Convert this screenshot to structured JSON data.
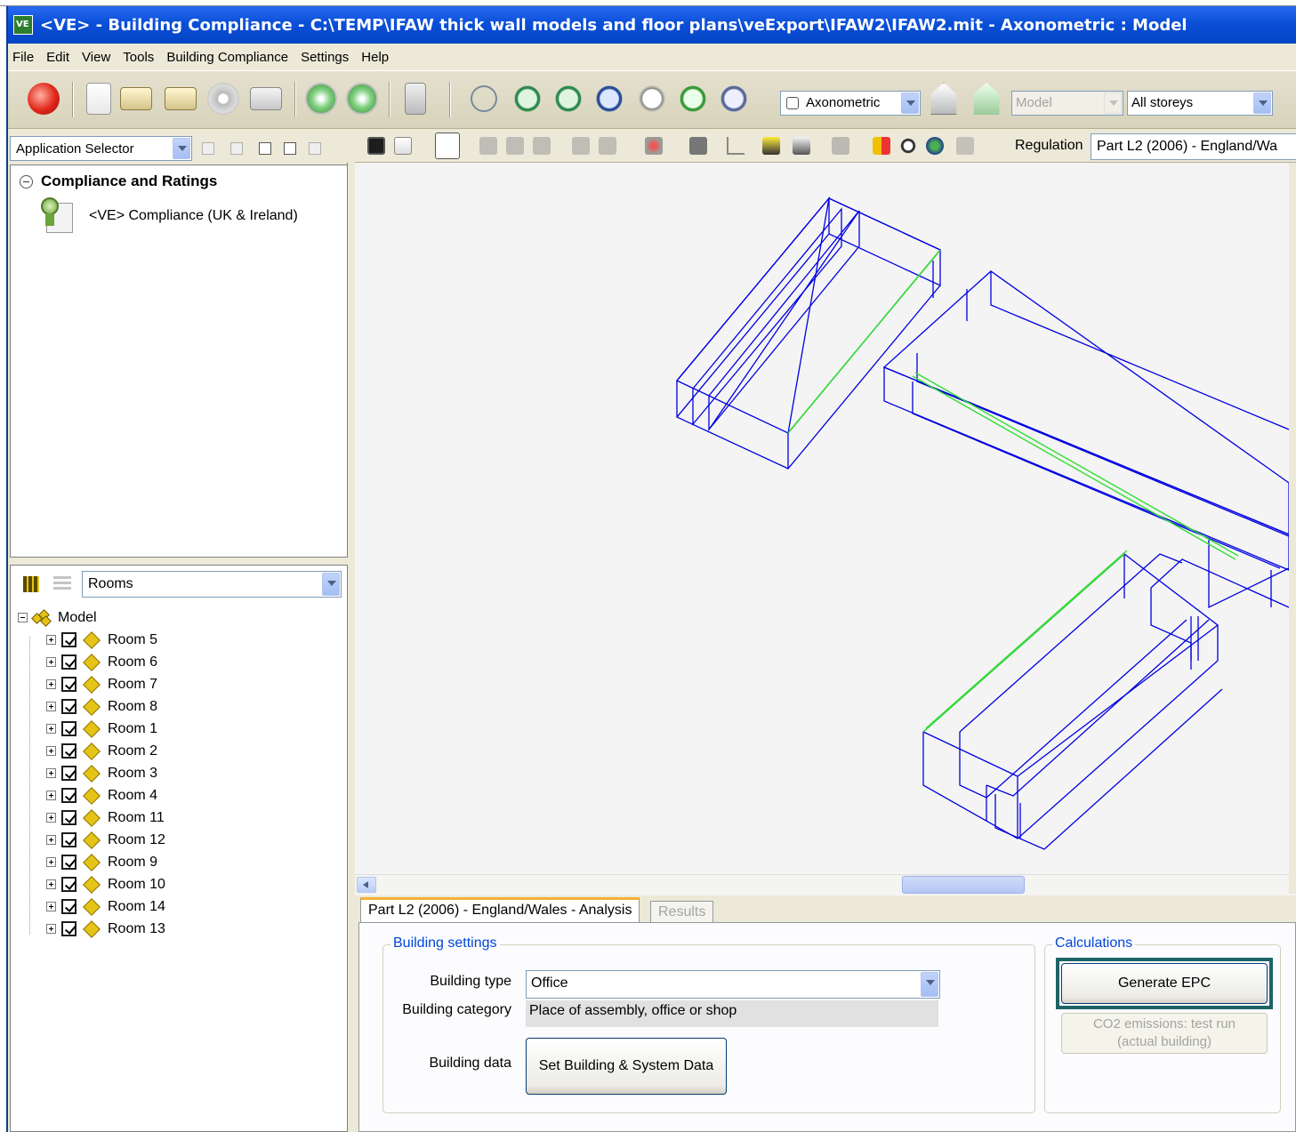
{
  "window": {
    "title": "<VE> - Building Compliance - C:\\TEMP\\IFAW thick wall models and floor plans\\veExport\\IFAW2\\IFAW2.mit - Axonometric : Model"
  },
  "menu": [
    "File",
    "Edit",
    "View",
    "Tools",
    "Building Compliance",
    "Settings",
    "Help"
  ],
  "toolbar": {
    "view_select": "Axonometric",
    "model_select": "Model",
    "storey_select": "All storeys"
  },
  "left": {
    "app_selector": "Application Selector",
    "compliance_heading": "Compliance and Ratings",
    "compliance_item": "<VE> Compliance (UK & Ireland)",
    "browser_select": "Rooms",
    "tree_root": "Model",
    "rooms": [
      "Room 5",
      "Room 6",
      "Room 7",
      "Room 8",
      "Room 1",
      "Room 2",
      "Room 3",
      "Room 4",
      "Room 11",
      "Room 12",
      "Room 9",
      "Room 10",
      "Room 14",
      "Room 13"
    ]
  },
  "viewport": {
    "regulation_label": "Regulation",
    "regulation_value": "Part L2 (2006) - England/Wa",
    "wire_color": "#0000e0",
    "highlight_color": "#33dd33"
  },
  "analysis": {
    "tab_active": "Part L2 (2006) - England/Wales - Analysis",
    "tab_inactive": "Results",
    "building_settings_title": "Building settings",
    "building_type_label": "Building type",
    "building_type_value": "Office",
    "building_category_label": "Building category",
    "building_category_value": "Place of assembly, office or shop",
    "building_data_label": "Building data",
    "set_data_button": "Set Building & System Data",
    "calculations_title": "Calculations",
    "generate_epc_button": "Generate EPC",
    "co2_button_line1": "CO2 emissions: test run",
    "co2_button_line2": "(actual building)"
  }
}
